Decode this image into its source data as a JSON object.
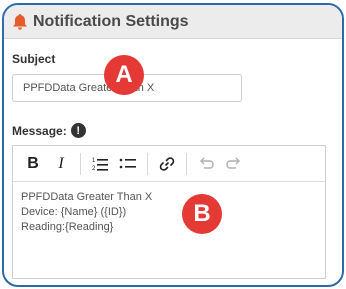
{
  "header": {
    "title": "Notification Settings",
    "icon": "bell-icon",
    "icon_color": "#e65a2b"
  },
  "subject": {
    "label": "Subject",
    "value": "PPFDData Greater Than X"
  },
  "message": {
    "label": "Message:",
    "info_icon_text": "!",
    "content_lines": [
      "PPFDData Greater Than X",
      "Device: {Name} ({ID})",
      "Reading:{Reading}"
    ]
  },
  "toolbar": {
    "bold": "B",
    "italic": "I"
  },
  "annotations": {
    "a": "A",
    "b": "B",
    "color": "#e53935"
  },
  "colors": {
    "frame_border": "#2f6aa8",
    "header_bg": "#ececec"
  }
}
